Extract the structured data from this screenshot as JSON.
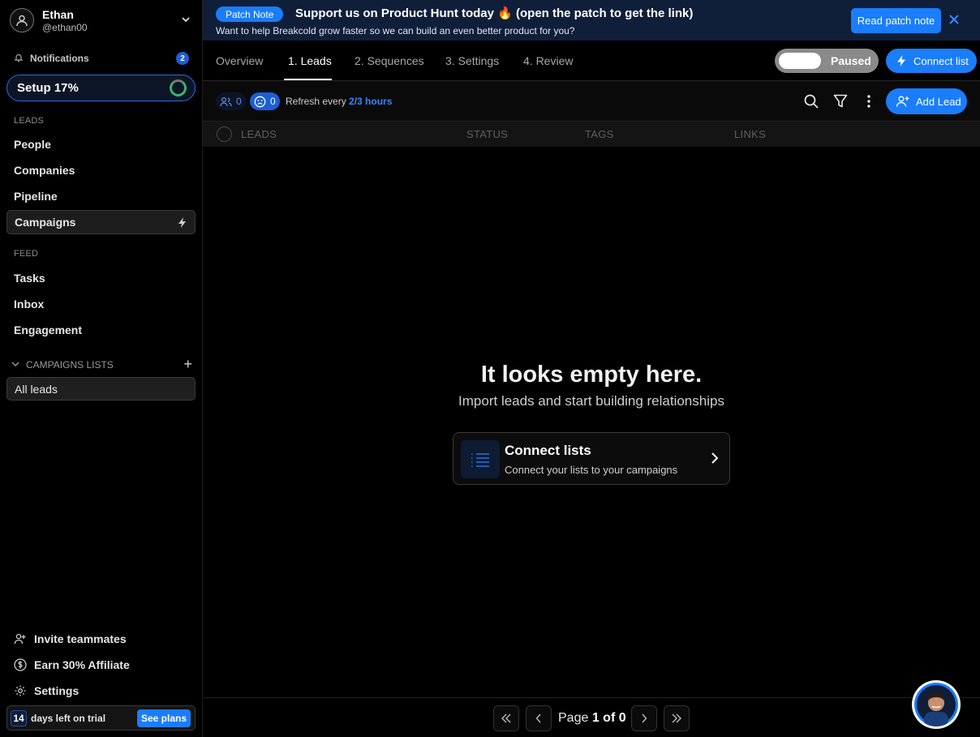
{
  "user": {
    "name": "Ethan",
    "handle": "@ethan00"
  },
  "sidebar": {
    "notifications_label": "Notifications",
    "notifications_count": "2",
    "setup_label": "Setup 17%",
    "setup_progress": 0.17,
    "section_leads": "LEADS",
    "leads_items": [
      {
        "label": "People"
      },
      {
        "label": "Companies"
      },
      {
        "label": "Pipeline"
      },
      {
        "label": "Campaigns"
      }
    ],
    "section_feed": "FEED",
    "feed_items": [
      {
        "label": "Tasks"
      },
      {
        "label": "Inbox"
      },
      {
        "label": "Engagement"
      }
    ],
    "campaign_lists_label": "CAMPAIGNS LISTS",
    "all_leads_label": "All leads",
    "bottom_items": [
      {
        "label": "Invite teammates"
      },
      {
        "label": "Earn 30% Affiliate"
      },
      {
        "label": "Settings"
      }
    ],
    "trial_days": "14",
    "trial_text": "days left on trial",
    "see_plans_label": "See plans"
  },
  "banner": {
    "pill": "Patch Note",
    "title": "Support us on Product Hunt today 🔥 (open the patch to get the link)",
    "subtitle": "Want to help Breakcold grow faster so we can build an even better product for you?",
    "read_button": "Read patch note"
  },
  "tabs": [
    {
      "label": "Overview"
    },
    {
      "label": "1. Leads"
    },
    {
      "label": "2. Sequences"
    },
    {
      "label": "3. Settings"
    },
    {
      "label": "4. Review"
    }
  ],
  "toggle_label": "Paused",
  "connect_list_label": "Connect list",
  "filterbar": {
    "people_count": "0",
    "active_count": "0",
    "refresh_prefix": "Refresh every ",
    "refresh_value": "2/3 hours",
    "add_lead_label": "Add Lead"
  },
  "table": {
    "columns": [
      "LEADS",
      "STATUS",
      "TAGS",
      "LINKS"
    ]
  },
  "empty": {
    "title": "It looks empty here.",
    "subtitle": "Import leads and start building relationships",
    "card_title": "Connect lists",
    "card_subtitle": "Connect your lists to your campaigns"
  },
  "pager": {
    "page_prefix": "Page ",
    "page_current": "1",
    "page_of": " of ",
    "page_total": "0"
  },
  "colors": {
    "accent": "#1a7dfb",
    "banner_bg": "#0f1f3a",
    "setup_ring": "#3ab36b"
  }
}
